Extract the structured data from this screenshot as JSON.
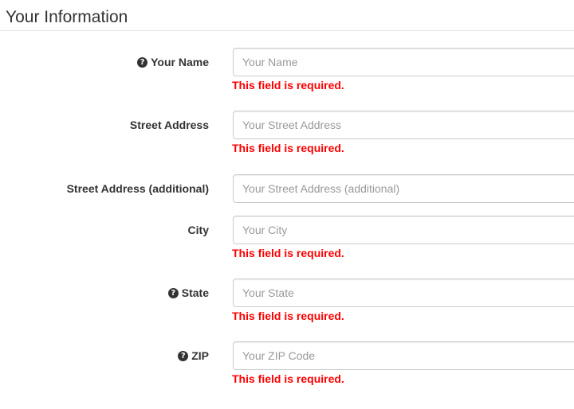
{
  "section": {
    "title": "Your Information"
  },
  "fields": [
    {
      "label": "Your Name",
      "has_help": true,
      "placeholder": "Your Name",
      "value": "",
      "error": "This field is required."
    },
    {
      "label": "Street Address",
      "has_help": false,
      "placeholder": "Your Street Address",
      "value": "",
      "error": "This field is required."
    },
    {
      "label": "Street Address (additional)",
      "has_help": false,
      "placeholder": "Your Street Address (additional)",
      "value": "",
      "error": ""
    },
    {
      "label": "City",
      "has_help": false,
      "placeholder": "Your City",
      "value": "",
      "error": "This field is required."
    },
    {
      "label": "State",
      "has_help": true,
      "placeholder": "Your State",
      "value": "",
      "error": "This field is required."
    },
    {
      "label": "ZIP",
      "has_help": true,
      "placeholder": "Your ZIP Code",
      "value": "",
      "error": "This field is required."
    }
  ],
  "icons": {
    "help": "question-circle-icon"
  },
  "colors": {
    "error": "#ff0000",
    "label": "#333333",
    "placeholder": "#999999",
    "input_border": "#cccccc"
  }
}
